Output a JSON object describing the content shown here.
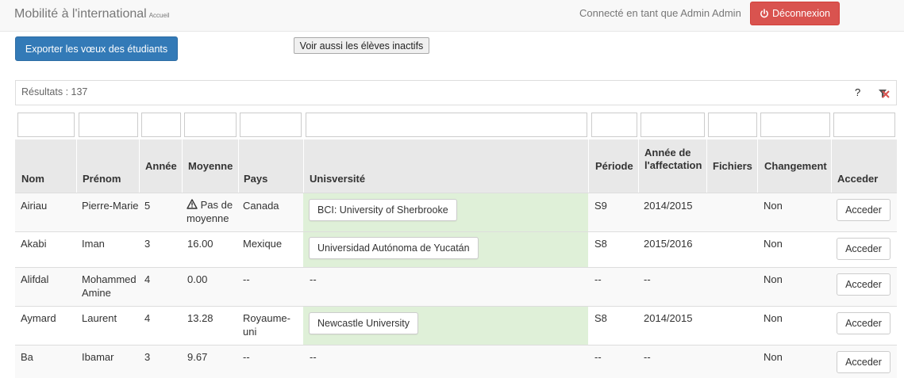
{
  "header": {
    "brand": "Mobilité à l'international",
    "brand_sub": "Accueil",
    "connected_text": "Connecté en tant que Admin Admin",
    "logout_label": "Déconnexion"
  },
  "toolbar": {
    "export_label": "Exporter les vœux des étudiants",
    "inactive_label": "Voir aussi les élèves inactifs"
  },
  "results": {
    "text": "Résultats : 137",
    "help": "?"
  },
  "table": {
    "columns": [
      "Nom",
      "Prénom",
      "Année",
      "Moyenne",
      "Pays",
      "Unisversité",
      "Période",
      "Année de l'affectation",
      "Fichiers",
      "Changement",
      "Acceder"
    ],
    "rows": [
      {
        "nom": "Airiau",
        "prenom": "Pierre-Marie",
        "annee": "5",
        "moyenne": "Pas de moyenne",
        "pays": "Canada",
        "universite": "BCI: University of Sherbrooke",
        "periode": "S9",
        "affectation": "2014/2015",
        "fichiers": "",
        "changement": "Non",
        "acceder": "Acceder"
      },
      {
        "nom": "Akabi",
        "prenom": "Iman",
        "annee": "3",
        "moyenne": "16.00",
        "pays": "Mexique",
        "universite": "Universidad Autónoma de Yucatán",
        "periode": "S8",
        "affectation": "2015/2016",
        "fichiers": "",
        "changement": "Non",
        "acceder": "Acceder"
      },
      {
        "nom": "Alifdal",
        "prenom": "Mohammed Amine",
        "annee": "4",
        "moyenne": "0.00",
        "pays": "--",
        "universite": "--",
        "periode": "--",
        "affectation": "--",
        "fichiers": "",
        "changement": "Non",
        "acceder": "Acceder"
      },
      {
        "nom": "Aymard",
        "prenom": "Laurent",
        "annee": "4",
        "moyenne": "13.28",
        "pays": "Royaume-uni",
        "universite": "Newcastle University",
        "periode": "S8",
        "affectation": "2014/2015",
        "fichiers": "",
        "changement": "Non",
        "acceder": "Acceder"
      },
      {
        "nom": "Ba",
        "prenom": "Ibamar",
        "annee": "3",
        "moyenne": "9.67",
        "pays": "--",
        "universite": "--",
        "periode": "--",
        "affectation": "--",
        "fichiers": "",
        "changement": "Non",
        "acceder": "Acceder"
      }
    ]
  },
  "colors": {
    "primary": "#337ab7",
    "danger": "#d9534f",
    "assigned_row": "#dff0d8"
  }
}
